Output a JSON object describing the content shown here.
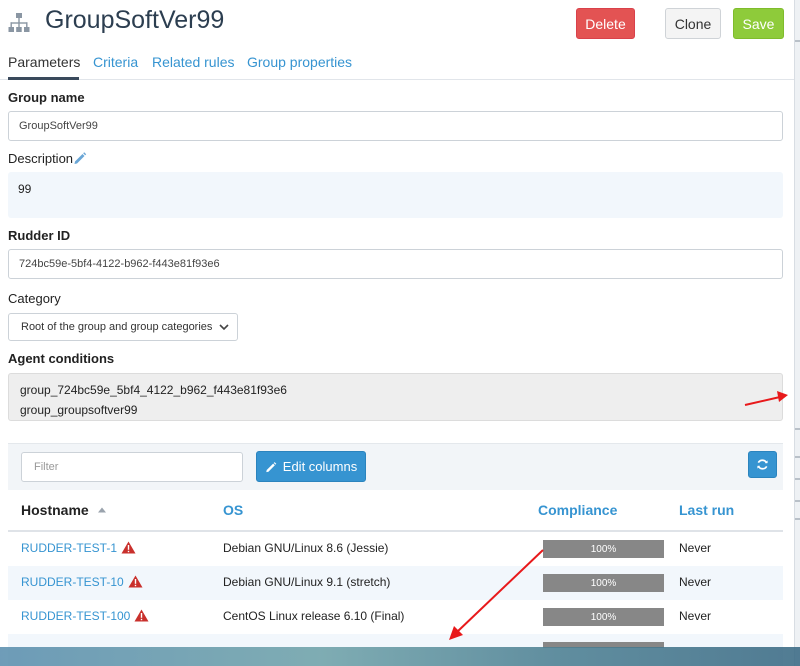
{
  "header": {
    "title": "GroupSoftVer99",
    "delete_label": "Delete",
    "clone_label": "Clone",
    "save_label": "Save"
  },
  "tabs": [
    {
      "label": "Parameters",
      "active": true
    },
    {
      "label": "Criteria"
    },
    {
      "label": "Related rules"
    },
    {
      "label": "Group properties"
    }
  ],
  "form": {
    "group_name_label": "Group name",
    "group_name_value": "GroupSoftVer99",
    "description_label": "Description",
    "description_value": "99",
    "rudder_id_label": "Rudder ID",
    "rudder_id_value": "724bc59e-5bf4-4122-b962-f443e81f93e6",
    "category_label": "Category",
    "category_value": "Root of the group and group categories",
    "agent_conditions_label": "Agent conditions",
    "agent_conditions": [
      "group_724bc59e_5bf4_4122_b962_f443e81f93e6",
      "group_groupsoftver99"
    ]
  },
  "table": {
    "filter_placeholder": "Filter",
    "edit_columns_label": "Edit columns",
    "columns": [
      "Hostname",
      "OS",
      "Compliance",
      "Last run"
    ],
    "rows": [
      {
        "hostname": "RUDDER-TEST-1",
        "os": "Debian GNU/Linux 8.6 (Jessie)",
        "compliance": "100%",
        "last_run": "Never"
      },
      {
        "hostname": "RUDDER-TEST-10",
        "os": "Debian GNU/Linux 9.1 (stretch)",
        "compliance": "100%",
        "last_run": "Never"
      },
      {
        "hostname": "RUDDER-TEST-100",
        "os": "CentOS Linux release 6.10 (Final)",
        "compliance": "100%",
        "last_run": "Never"
      }
    ]
  },
  "colors": {
    "accent": "#3694d1",
    "delete": "#e35353",
    "save": "#8ecb3a",
    "warning": "#c9302c",
    "annotation": "#e8191b"
  },
  "icons": [
    "org-chart-icon",
    "pencil-icon",
    "chevron-down-icon",
    "edit-icon",
    "refresh-icon",
    "warning-icon",
    "sort-asc-icon"
  ]
}
